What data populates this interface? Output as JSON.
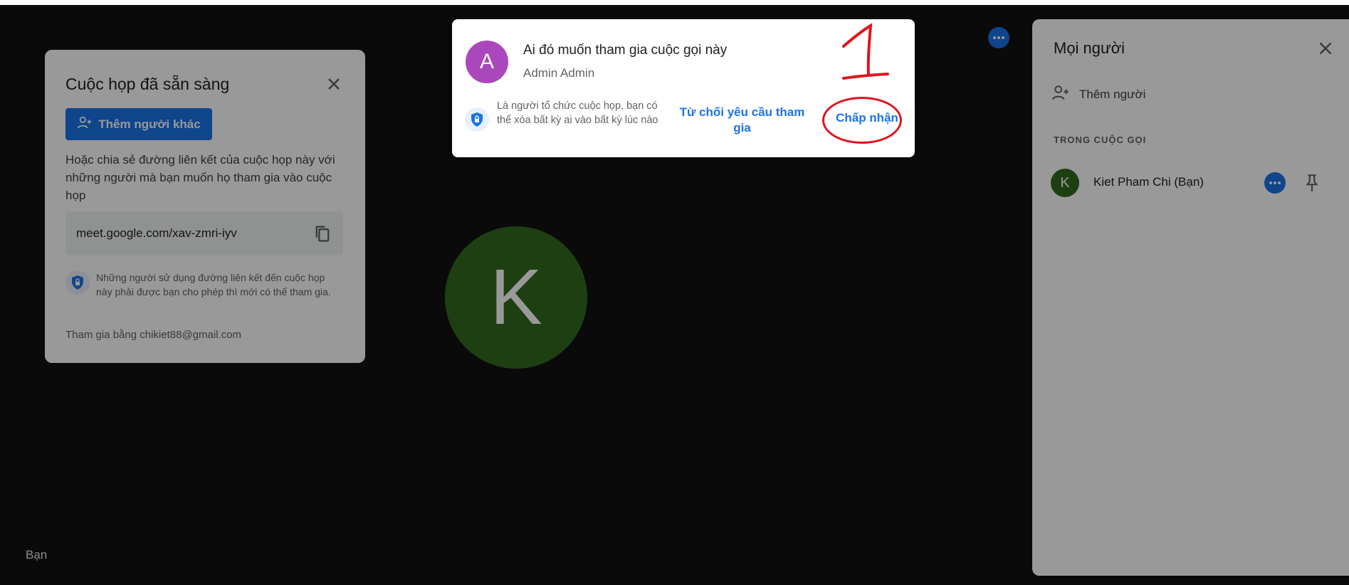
{
  "ready_card": {
    "title": "Cuộc họp đã sẵn sàng",
    "add_button": "Thêm người khác",
    "description": "Hoặc chia sẻ đường liên kết của cuộc họp này với những người mà bạn muốn họ tham gia vào cuộc họp",
    "link": "meet.google.com/xav-zmri-iyv",
    "note": "Những người sử dụng đường liên kết đến cuộc họp này phải được bạn cho phép thì mới có thể tham gia.",
    "joined_as": "Tham gia bằng chikiet88@gmail.com"
  },
  "stage": {
    "avatar_letter": "K",
    "you_label": "Bạn"
  },
  "popup": {
    "avatar_letter": "A",
    "message": "Ai đó muốn tham gia cuộc gọi này",
    "requester": "Admin Admin",
    "note": "Là người tổ chức cuộc họp, bạn có thể xóa bất kỳ ai vào bất kỳ lúc nào",
    "reject_label": "Từ chối yêu cầu tham gia",
    "accept_label": "Chấp nhận",
    "annotation_number": "1"
  },
  "people_panel": {
    "title": "Mọi người",
    "add_people": "Thêm người",
    "section_label": "TRONG CUỘC GỌI",
    "members": [
      {
        "avatar_letter": "K",
        "name": "Kiet Pham Chi (Bạn)"
      }
    ]
  },
  "colors": {
    "accent": "#1a73e8",
    "stage_bg": "#111111",
    "avatar_green": "#33691e",
    "avatar_purple": "#ab47bc",
    "annotation_red": "#e0141e"
  }
}
